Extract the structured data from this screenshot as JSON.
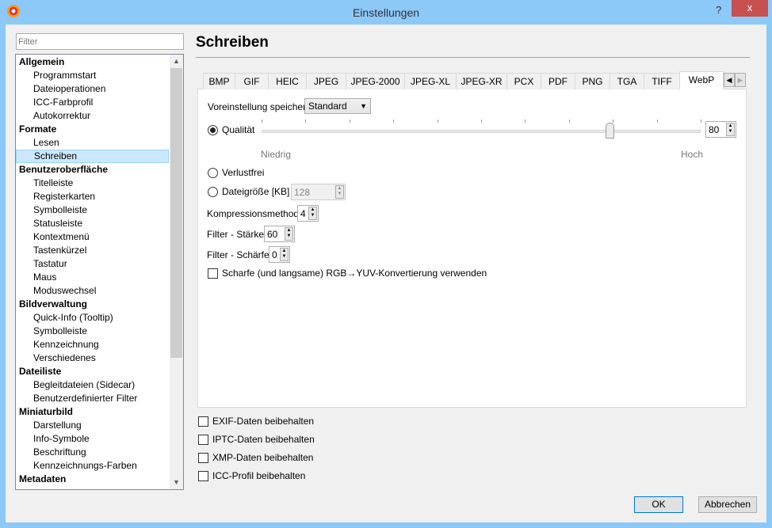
{
  "window": {
    "title": "Einstellungen",
    "help": "?",
    "close": "x"
  },
  "filter": {
    "placeholder": "Filter"
  },
  "tree": [
    {
      "label": "Allgemein",
      "level": 0
    },
    {
      "label": "Programmstart",
      "level": 1
    },
    {
      "label": "Dateioperationen",
      "level": 1
    },
    {
      "label": "ICC-Farbprofil",
      "level": 1
    },
    {
      "label": "Autokorrektur",
      "level": 1
    },
    {
      "label": "Formate",
      "level": 0
    },
    {
      "label": "Lesen",
      "level": 1
    },
    {
      "label": "Schreiben",
      "level": 1,
      "selected": true
    },
    {
      "label": "Benutzeroberfläche",
      "level": 0
    },
    {
      "label": "Titelleiste",
      "level": 1
    },
    {
      "label": "Registerkarten",
      "level": 1
    },
    {
      "label": "Symbolleiste",
      "level": 1
    },
    {
      "label": "Statusleiste",
      "level": 1
    },
    {
      "label": "Kontextmenü",
      "level": 1
    },
    {
      "label": "Tastenkürzel",
      "level": 1
    },
    {
      "label": "Tastatur",
      "level": 1
    },
    {
      "label": "Maus",
      "level": 1
    },
    {
      "label": "Moduswechsel",
      "level": 1
    },
    {
      "label": "Bildverwaltung",
      "level": 0
    },
    {
      "label": "Quick-Info (Tooltip)",
      "level": 1
    },
    {
      "label": "Symbolleiste",
      "level": 1
    },
    {
      "label": "Kennzeichnung",
      "level": 1
    },
    {
      "label": "Verschiedenes",
      "level": 1
    },
    {
      "label": "Dateiliste",
      "level": 0
    },
    {
      "label": "Begleitdateien (Sidecar)",
      "level": 1
    },
    {
      "label": "Benutzerdefinierter Filter",
      "level": 1
    },
    {
      "label": "Miniaturbild",
      "level": 0
    },
    {
      "label": "Darstellung",
      "level": 1
    },
    {
      "label": "Info-Symbole",
      "level": 1
    },
    {
      "label": "Beschriftung",
      "level": 1
    },
    {
      "label": "Kennzeichnungs-Farben",
      "level": 1
    },
    {
      "label": "Metadaten",
      "level": 0
    }
  ],
  "page": {
    "title": "Schreiben"
  },
  "tabs": [
    "BMP",
    "GIF",
    "HEIC",
    "JPEG",
    "JPEG-2000",
    "JPEG-XL",
    "JPEG-XR",
    "PCX",
    "PDF",
    "PNG",
    "TGA",
    "TIFF",
    "WebP"
  ],
  "active_tab": "WebP",
  "webp": {
    "preset_label": "Voreinstellung speichern",
    "preset_value": "Standard",
    "quality_label": "Qualität",
    "quality_value": "80",
    "quality_fraction": 0.8,
    "low_label": "Niedrig",
    "high_label": "Hoch",
    "lossless_label": "Verlustfrei",
    "filesize_label": "Dateigröße [KB]",
    "filesize_value": "128",
    "method_label": "Kompressionsmethode",
    "method_value": "4",
    "strength_label": "Filter - Stärke",
    "strength_value": "60",
    "sharpness_label": "Filter - Schärfe",
    "sharpness_value": "0",
    "sharp_yuv_label": "Scharfe (und langsame) RGB→YUV-Konvertierung verwenden"
  },
  "keep": [
    "EXIF-Daten beibehalten",
    "IPTC-Daten beibehalten",
    "XMP-Daten beibehalten",
    "ICC-Profil beibehalten"
  ],
  "buttons": {
    "ok": "OK",
    "cancel": "Abbrechen"
  }
}
